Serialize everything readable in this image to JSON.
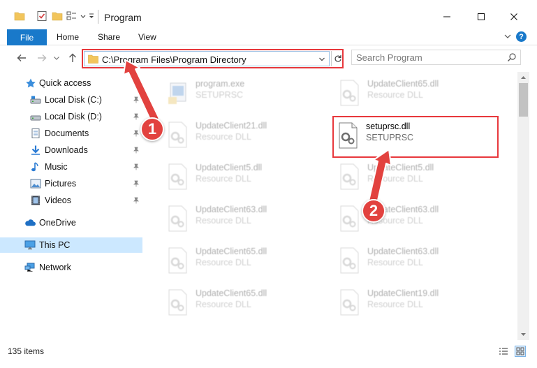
{
  "window": {
    "title": "Program",
    "minimize_glyph": "—",
    "maximize_glyph": "☐",
    "close_glyph": "✕"
  },
  "ribbon": {
    "tabs": [
      {
        "label": "File"
      },
      {
        "label": "Home"
      },
      {
        "label": "Share"
      },
      {
        "label": "View"
      }
    ],
    "help_label": "?"
  },
  "address": {
    "path": "C:\\Program Files\\Program Directory"
  },
  "search": {
    "placeholder": "Search Program"
  },
  "nav": {
    "items": [
      {
        "label": "Quick access",
        "icon": "star-icon"
      },
      {
        "label": "Local Disk (C:)",
        "icon": "drive-icon"
      },
      {
        "label": "Local Disk (D:)",
        "icon": "drive-icon"
      },
      {
        "label": "Documents",
        "icon": "documents-icon"
      },
      {
        "label": "Downloads",
        "icon": "download-icon"
      },
      {
        "label": "Music",
        "icon": "music-icon"
      },
      {
        "label": "Pictures",
        "icon": "pictures-icon"
      },
      {
        "label": "Videos",
        "icon": "videos-icon"
      },
      {
        "label": "OneDrive",
        "icon": "cloud-icon"
      },
      {
        "label": "This PC",
        "icon": "computer-icon"
      },
      {
        "label": "Network",
        "icon": "network-icon"
      }
    ]
  },
  "files": [
    {
      "name": "program.exe",
      "desc": "SETUPRSC"
    },
    {
      "name": "UpdateClient65.dll",
      "desc": "Resource DLL"
    },
    {
      "name": "UpdateClient21.dll",
      "desc": "Resource DLL"
    },
    {
      "name": "setuprsc.dll",
      "desc": "SETUPRSC"
    },
    {
      "name": "UpdateClient5.dll",
      "desc": "Resource DLL"
    },
    {
      "name": "UpdateClient5.dll",
      "desc": "Resource DLL"
    },
    {
      "name": "UpdateClient63.dll",
      "desc": "Resource DLL"
    },
    {
      "name": "UpdateClient63.dll",
      "desc": "Resource DLL"
    },
    {
      "name": "UpdateClient65.dll",
      "desc": "Resource DLL"
    },
    {
      "name": "UpdateClient63.dll",
      "desc": "Resource DLL"
    },
    {
      "name": "UpdateClient65.dll",
      "desc": "Resource DLL"
    },
    {
      "name": "UpdateClient19.dll",
      "desc": "Resource DLL"
    }
  ],
  "status": {
    "item_count": "135 items"
  },
  "annotations": {
    "step1": "1",
    "step2": "2"
  },
  "colors": {
    "accent": "#1979ca",
    "highlight": "#e8383c",
    "arrow": "#e2423f",
    "selection": "#cce8ff"
  }
}
